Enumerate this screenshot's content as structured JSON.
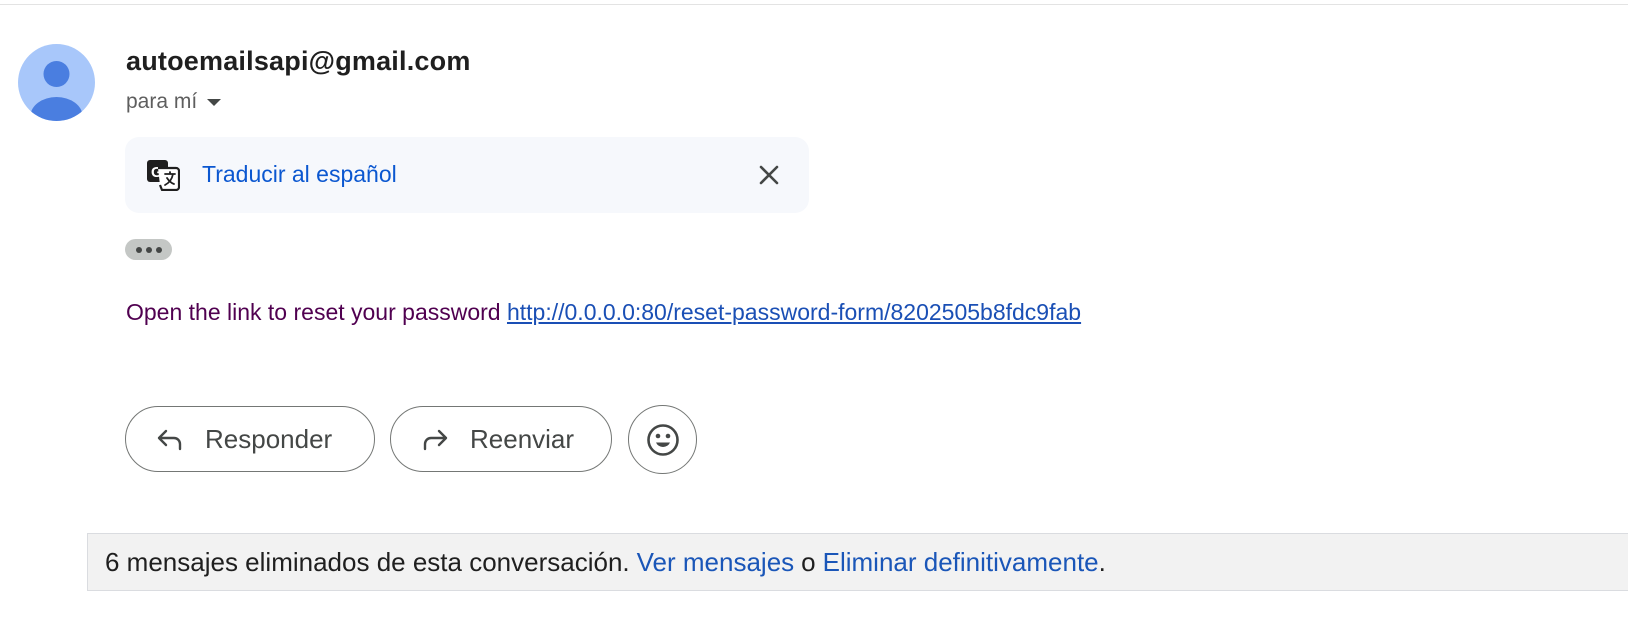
{
  "message": {
    "sender": "autoemailsapi@gmail.com",
    "recipient_label": "para mí"
  },
  "translate_bar": {
    "link_label": "Traducir al español"
  },
  "body": {
    "text": "Open the link to reset your password",
    "link": "http://0.0.0.0:80/reset-password-form/8202505b8fdc9fab"
  },
  "actions": {
    "reply_label": "Responder",
    "forward_label": "Reenviar"
  },
  "deleted_notice": {
    "text": "6 mensajes eliminados de esta conversación.",
    "view_link": "Ver mensajes",
    "separator": "o",
    "delete_link": "Eliminar definitivamente",
    "end": "."
  },
  "icons": {
    "avatar": "default-person-avatar-icon",
    "recipient_dropdown": "caret-down-icon",
    "translate": "google-translate-icon",
    "close": "close-icon",
    "more": "ellipsis-icon",
    "reply": "reply-arrow-icon",
    "forward": "forward-arrow-icon",
    "emoji": "smiley-emoji-icon"
  },
  "colors": {
    "link_blue": "#0b57d0",
    "body_text": "#500050",
    "avatar_bg": "#a8c7fa",
    "avatar_fg": "#4a7ee0",
    "translate_bg": "#f6f8fc"
  }
}
